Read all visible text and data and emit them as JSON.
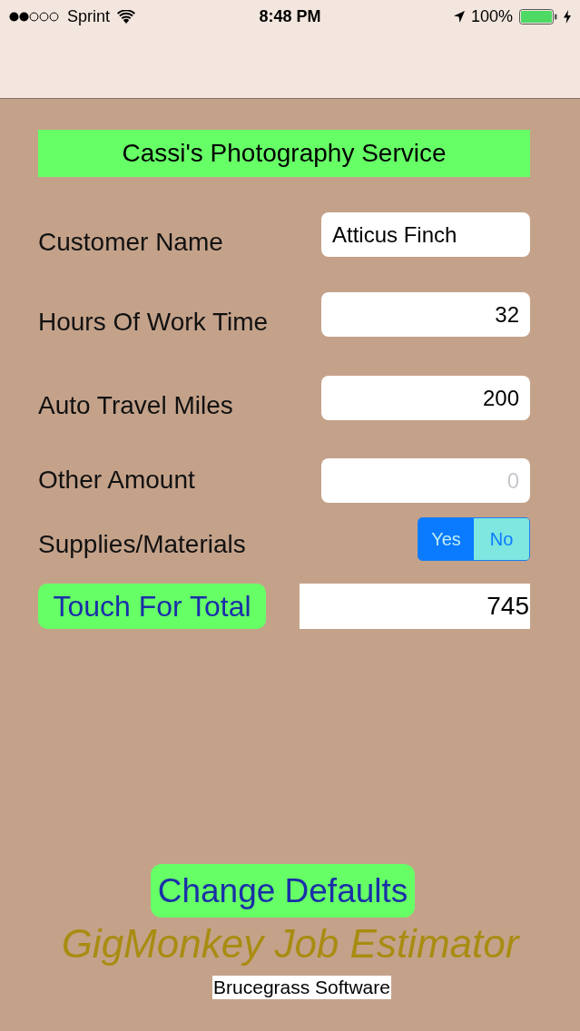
{
  "status_bar": {
    "carrier": "Sprint",
    "time": "8:48 PM",
    "battery": "100%"
  },
  "header": {
    "title": "Cassi's Photography Service"
  },
  "fields": [
    {
      "kind": "text",
      "label": "Customer Name",
      "value": "Atticus Finch"
    },
    {
      "kind": "number",
      "label": "Hours Of Work Time",
      "value": "32"
    },
    {
      "kind": "number",
      "label": "Auto Travel Miles",
      "value": "200"
    },
    {
      "kind": "number",
      "label": "Other Amount",
      "placeholder": "0"
    },
    {
      "kind": "segmented",
      "label": "Supplies/Materials",
      "options": [
        {
          "label": "Yes",
          "selected": true
        },
        {
          "label": "No",
          "selected": false
        }
      ]
    }
  ],
  "total": {
    "button": "Touch For Total",
    "value": "745"
  },
  "defaults_button": "Change Defaults",
  "app_title": "GigMonkey Job Estimator",
  "publisher": "Brucegrass Software"
}
